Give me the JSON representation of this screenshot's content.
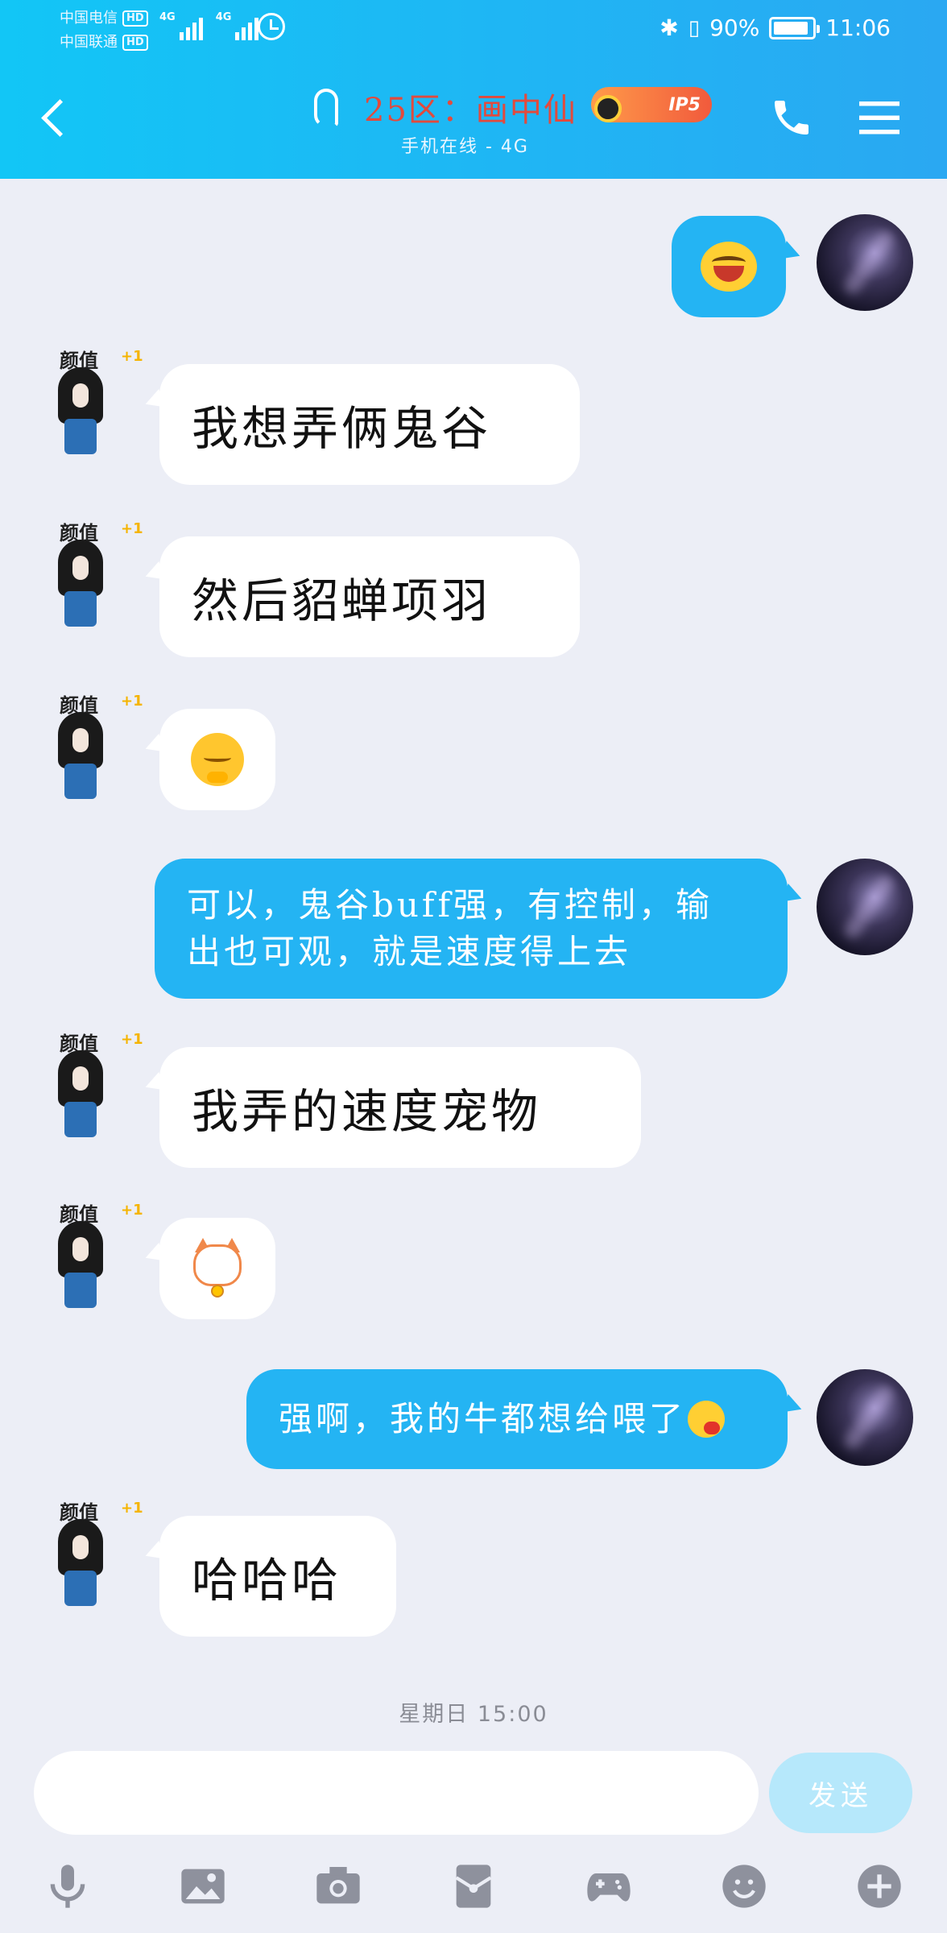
{
  "status_bar": {
    "carrier1": "中国电信",
    "carrier2": "中国联通",
    "hd": "HD",
    "net1": "4G",
    "net2": "4G",
    "battery_pct": "90%",
    "battery_level": 0.9,
    "time": "11:06"
  },
  "header": {
    "title": "25区：画中仙",
    "vip_badge": "IP5",
    "subtitle": "手机在线 - 4G"
  },
  "messages": [
    {
      "sender": "self",
      "type": "emoji",
      "emoji": "laugh-tears-icon"
    },
    {
      "sender": "other",
      "type": "text",
      "text": "我想弄俩鬼谷"
    },
    {
      "sender": "other",
      "type": "text",
      "text": "然后貂蝉项羽"
    },
    {
      "sender": "other",
      "type": "emoji",
      "emoji": "shy-face-icon"
    },
    {
      "sender": "self",
      "type": "text",
      "line1": "可以，鬼谷buff强，有控制，输",
      "line2": "出也可观，就是速度得上去"
    },
    {
      "sender": "other",
      "type": "text",
      "text": "我弄的速度宠物"
    },
    {
      "sender": "other",
      "type": "emoji",
      "emoji": "lucky-cat-icon"
    },
    {
      "sender": "self",
      "type": "text",
      "text": "强啊，我的牛都想给喂了"
    },
    {
      "sender": "other",
      "type": "text",
      "text": "哈哈哈"
    }
  ],
  "other_avatar": {
    "tag": "颜值",
    "plus": "+1"
  },
  "timestamp": "星期日 15:00",
  "input": {
    "placeholder": "",
    "send_label": "发送"
  },
  "toolbar": [
    "microphone-icon",
    "image-icon",
    "camera-icon",
    "red-packet-icon",
    "gamepad-icon",
    "emoji-icon",
    "plus-icon"
  ],
  "colors": {
    "header_start": "#12c6f6",
    "header_end": "#2aa8f2",
    "self_bubble": "#24b4f3",
    "other_bubble": "#ffffff",
    "background": "#eceef6",
    "title_red": "#e24a3d"
  }
}
